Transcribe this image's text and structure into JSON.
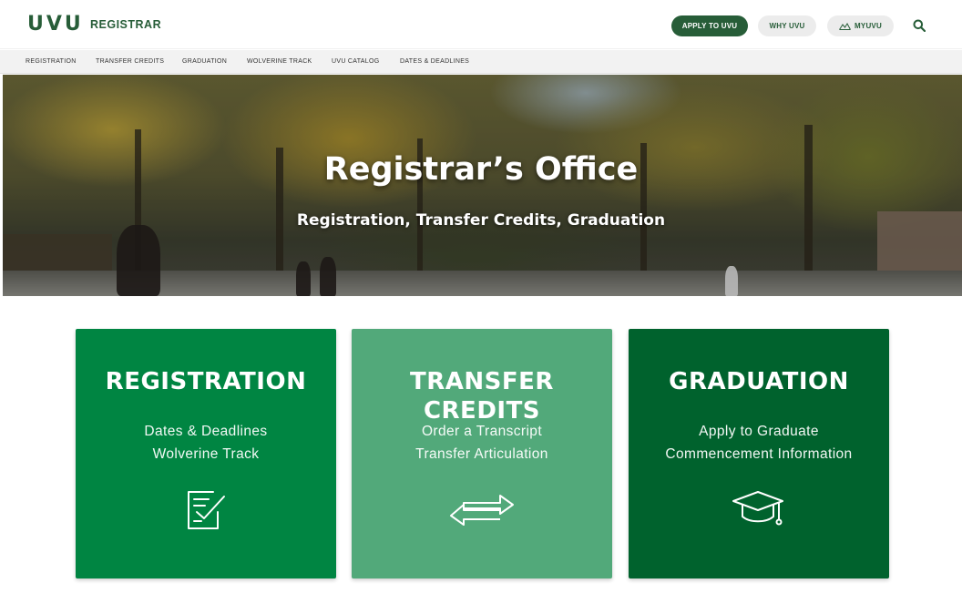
{
  "header": {
    "logo": "UVU",
    "site_name": "REGISTRAR",
    "apply_label": "APPLY TO UVU",
    "why_label": "WHY UVU",
    "myuvu_label": "MYUVU",
    "search_icon": "search-icon"
  },
  "subnav": {
    "items": [
      {
        "label": "REGISTRATION"
      },
      {
        "label": "TRANSFER CREDITS"
      },
      {
        "label": "GRADUATION"
      },
      {
        "label": "WOLVERINE TRACK"
      },
      {
        "label": "UVU CATALOG"
      },
      {
        "label": "DATES & DEADLINES"
      }
    ]
  },
  "hero": {
    "title": "Registrar’s Office",
    "subtitle": "Registration, Transfer Credits, Graduation"
  },
  "cards": [
    {
      "title": "REGISTRATION",
      "links": [
        "Dates & Deadlines",
        "Wolverine Track"
      ],
      "icon": "checklist-icon",
      "color": "#008542"
    },
    {
      "title": "TRANSFER CREDITS",
      "links": [
        "Order a Transcript",
        "Transfer Articulation"
      ],
      "icon": "transfer-arrows-icon",
      "color": "#52a97a"
    },
    {
      "title": "GRADUATION",
      "links": [
        "Apply to Graduate",
        "Commencement Information"
      ],
      "icon": "graduation-cap-icon",
      "color": "#00622d"
    }
  ],
  "colors": {
    "brand_green": "#275d38",
    "nav_bg": "#f2f2f2"
  }
}
